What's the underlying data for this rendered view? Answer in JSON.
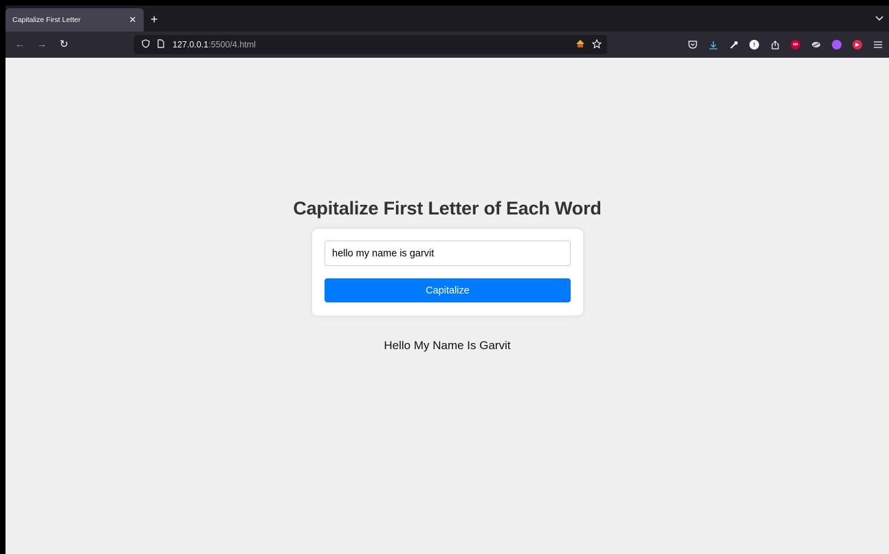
{
  "browser": {
    "tab": {
      "title": "Capitalize First Letter",
      "close": "✕"
    },
    "new_tab": "+",
    "tab_list": "⌵",
    "nav": {
      "back": "←",
      "forward": "→",
      "reload": "↻"
    },
    "url": {
      "host": "127.0.0.1",
      "rest": ":5500/4.html"
    },
    "icons": {
      "back": "back-arrow-icon",
      "forward": "forward-arrow-icon",
      "reload": "reload-icon",
      "shield": "tracking-protection-shield-icon",
      "page": "page-info-icon",
      "home": "home-icon",
      "bookmark": "bookmark-star-icon",
      "pocket": "pocket-icon",
      "download": "download-icon",
      "devtools": "wrench-icon",
      "info": "info-extension-icon",
      "share": "share-icon",
      "ublock": "ublock-origin-icon",
      "wave": "extension-icon",
      "plugin": "purple-extension-icon",
      "video": "video-extension-icon",
      "menu": "hamburger-menu-icon"
    },
    "accent_download": "#54ffbd"
  },
  "page": {
    "heading": "Capitalize First Letter of Each Word",
    "input_value": "hello my name is garvit",
    "button_label": "Capitalize",
    "result": "Hello My Name Is Garvit",
    "colors": {
      "button": "#007bff",
      "background": "#f0f0f0",
      "heading": "#333333"
    }
  }
}
